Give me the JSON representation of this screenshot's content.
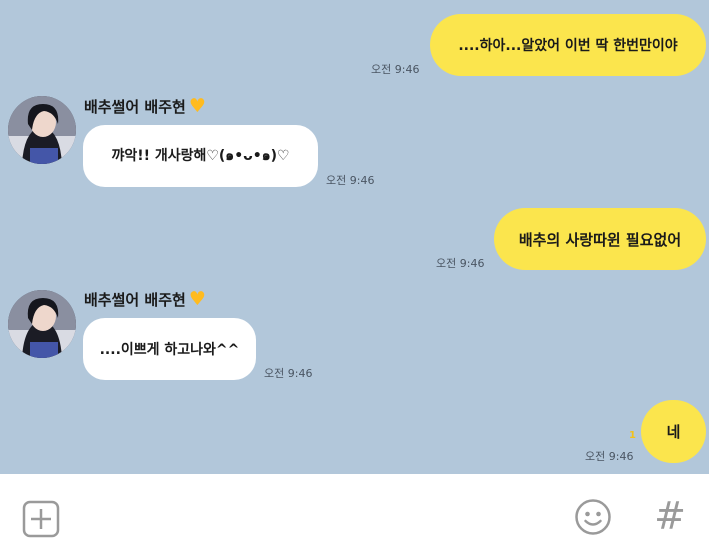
{
  "chat": {
    "messages": [
      {
        "id": "m1",
        "side": "me",
        "text": "....하아...알았어 이번 딱 한번만이야",
        "time": "오전 9:46"
      },
      {
        "id": "m2",
        "side": "other",
        "sender": "배추썰어 배주현",
        "text": "꺄악!! 개사랑해♡(๑•ᴗ•๑)♡",
        "time": "오전 9:46"
      },
      {
        "id": "m3",
        "side": "me",
        "text": "배추의 사랑따윈 필요없어",
        "time": "오전 9:46"
      },
      {
        "id": "m4",
        "side": "other",
        "sender": "배추썰어 배주현",
        "text": "....이쁘게 하고나와^^",
        "time": "오전 9:46"
      },
      {
        "id": "m5",
        "side": "me",
        "text": "네",
        "time": "오전 9:46",
        "unread": "1"
      }
    ],
    "sender_badge": "heart",
    "colors": {
      "background": "#b2c7da",
      "my_bubble": "#fbe54d",
      "their_bubble": "#ffffff",
      "heart": "#ffbb1f"
    }
  },
  "input_bar": {
    "icons": [
      "plus-icon",
      "emoji-icon",
      "hashtag-icon"
    ],
    "hashtag_symbol": "#"
  }
}
